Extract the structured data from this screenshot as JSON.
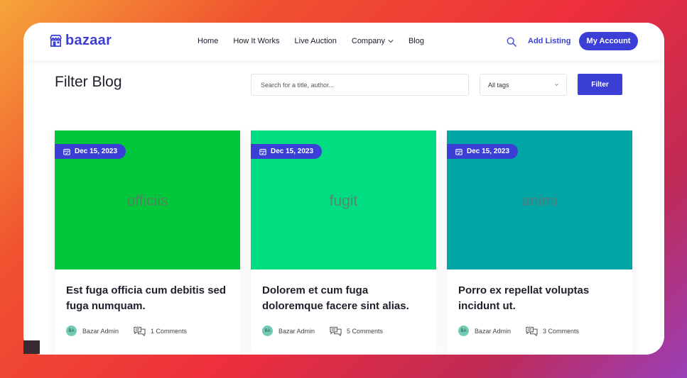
{
  "brand": {
    "name": "bazaar",
    "color": "#3b3fd6"
  },
  "nav": {
    "items": [
      {
        "label": "Home"
      },
      {
        "label": "How It Works"
      },
      {
        "label": "Live Auction"
      },
      {
        "label": "Company",
        "dropdown": true
      },
      {
        "label": "Blog"
      }
    ],
    "search_icon": "search-icon",
    "add_listing": "Add Listing",
    "account": "My Account"
  },
  "filter": {
    "title": "Filter Blog",
    "search_placeholder": "Search for a title, author...",
    "tags_selected": "All tags",
    "button": "Filter"
  },
  "posts": [
    {
      "date": "Dec 15, 2023",
      "image_word": "officiis",
      "image_color": "#00c83a",
      "title": "Est fuga officia cum debitis sed fuga numquam.",
      "author_initials": "BA",
      "author": "Bazar Admin",
      "comments": "1 Comments"
    },
    {
      "date": "Dec 15, 2023",
      "image_word": "fugit",
      "image_color": "#00dc80",
      "title": "Dolorem et cum fuga doloremque facere sint alias.",
      "author_initials": "BA",
      "author": "Bazar Admin",
      "comments": "5 Comments"
    },
    {
      "date": "Dec 15, 2023",
      "image_word": "animi",
      "image_color": "#00a6a6",
      "title": "Porro ex repellat voluptas incidunt ut.",
      "author_initials": "BA",
      "author": "Bazar Admin",
      "comments": "3 Comments"
    }
  ]
}
